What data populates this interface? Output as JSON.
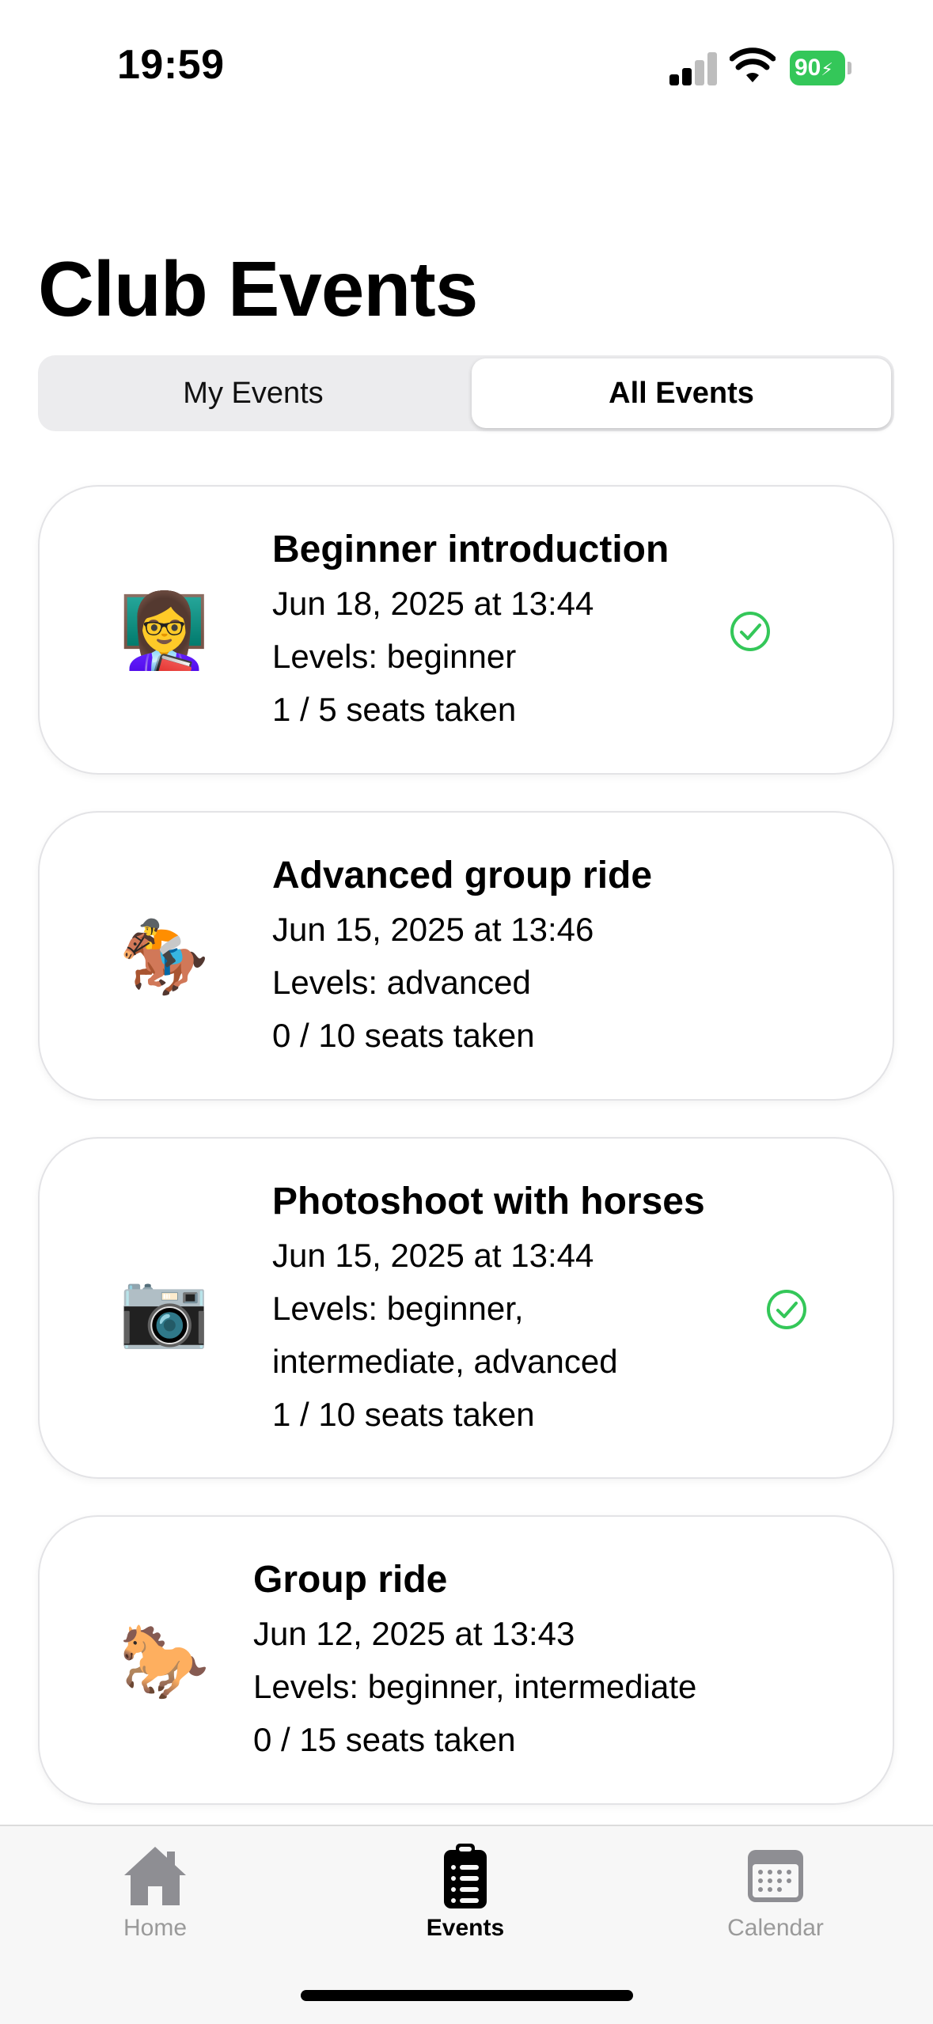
{
  "status_bar": {
    "time": "19:59",
    "battery": "90"
  },
  "header": {
    "title": "Club Events"
  },
  "segmented": {
    "left_label": "My Events",
    "right_label": "All Events",
    "selected": "All Events"
  },
  "events": [
    {
      "emoji": "👩‍🏫",
      "title": "Beginner introduction",
      "date": "Jun 18, 2025 at 13:44",
      "levels": "Levels: beginner",
      "levels_cont": "",
      "seats": "1 / 5 seats taken",
      "registered": true
    },
    {
      "emoji": "🏇",
      "title": "Advanced group ride",
      "date": "Jun 15, 2025 at 13:46",
      "levels": "Levels: advanced",
      "levels_cont": "",
      "seats": "0 / 10 seats taken",
      "registered": false
    },
    {
      "emoji": "📷",
      "title": "Photoshoot with horses",
      "date": "Jun 15, 2025 at 13:44",
      "levels": "Levels: beginner,",
      "levels_cont": "intermediate, advanced",
      "seats": "1 / 10 seats taken",
      "registered": true
    },
    {
      "emoji": "🐎",
      "title": "Group ride",
      "date": "Jun 12, 2025 at 13:43",
      "levels": "Levels: beginner, intermediate",
      "levels_cont": "",
      "seats": "0 / 15 seats taken",
      "registered": false
    }
  ],
  "tab_bar": {
    "tabs": [
      {
        "label": "Home",
        "icon": "house-icon",
        "active": false
      },
      {
        "label": "Events",
        "icon": "clipboard-list-icon",
        "active": true
      },
      {
        "label": "Calendar",
        "icon": "calendar-icon",
        "active": false
      }
    ]
  },
  "colors": {
    "accent_check": "#34c759",
    "battery": "#34c759",
    "inactive_tab": "#9a9a9a"
  }
}
